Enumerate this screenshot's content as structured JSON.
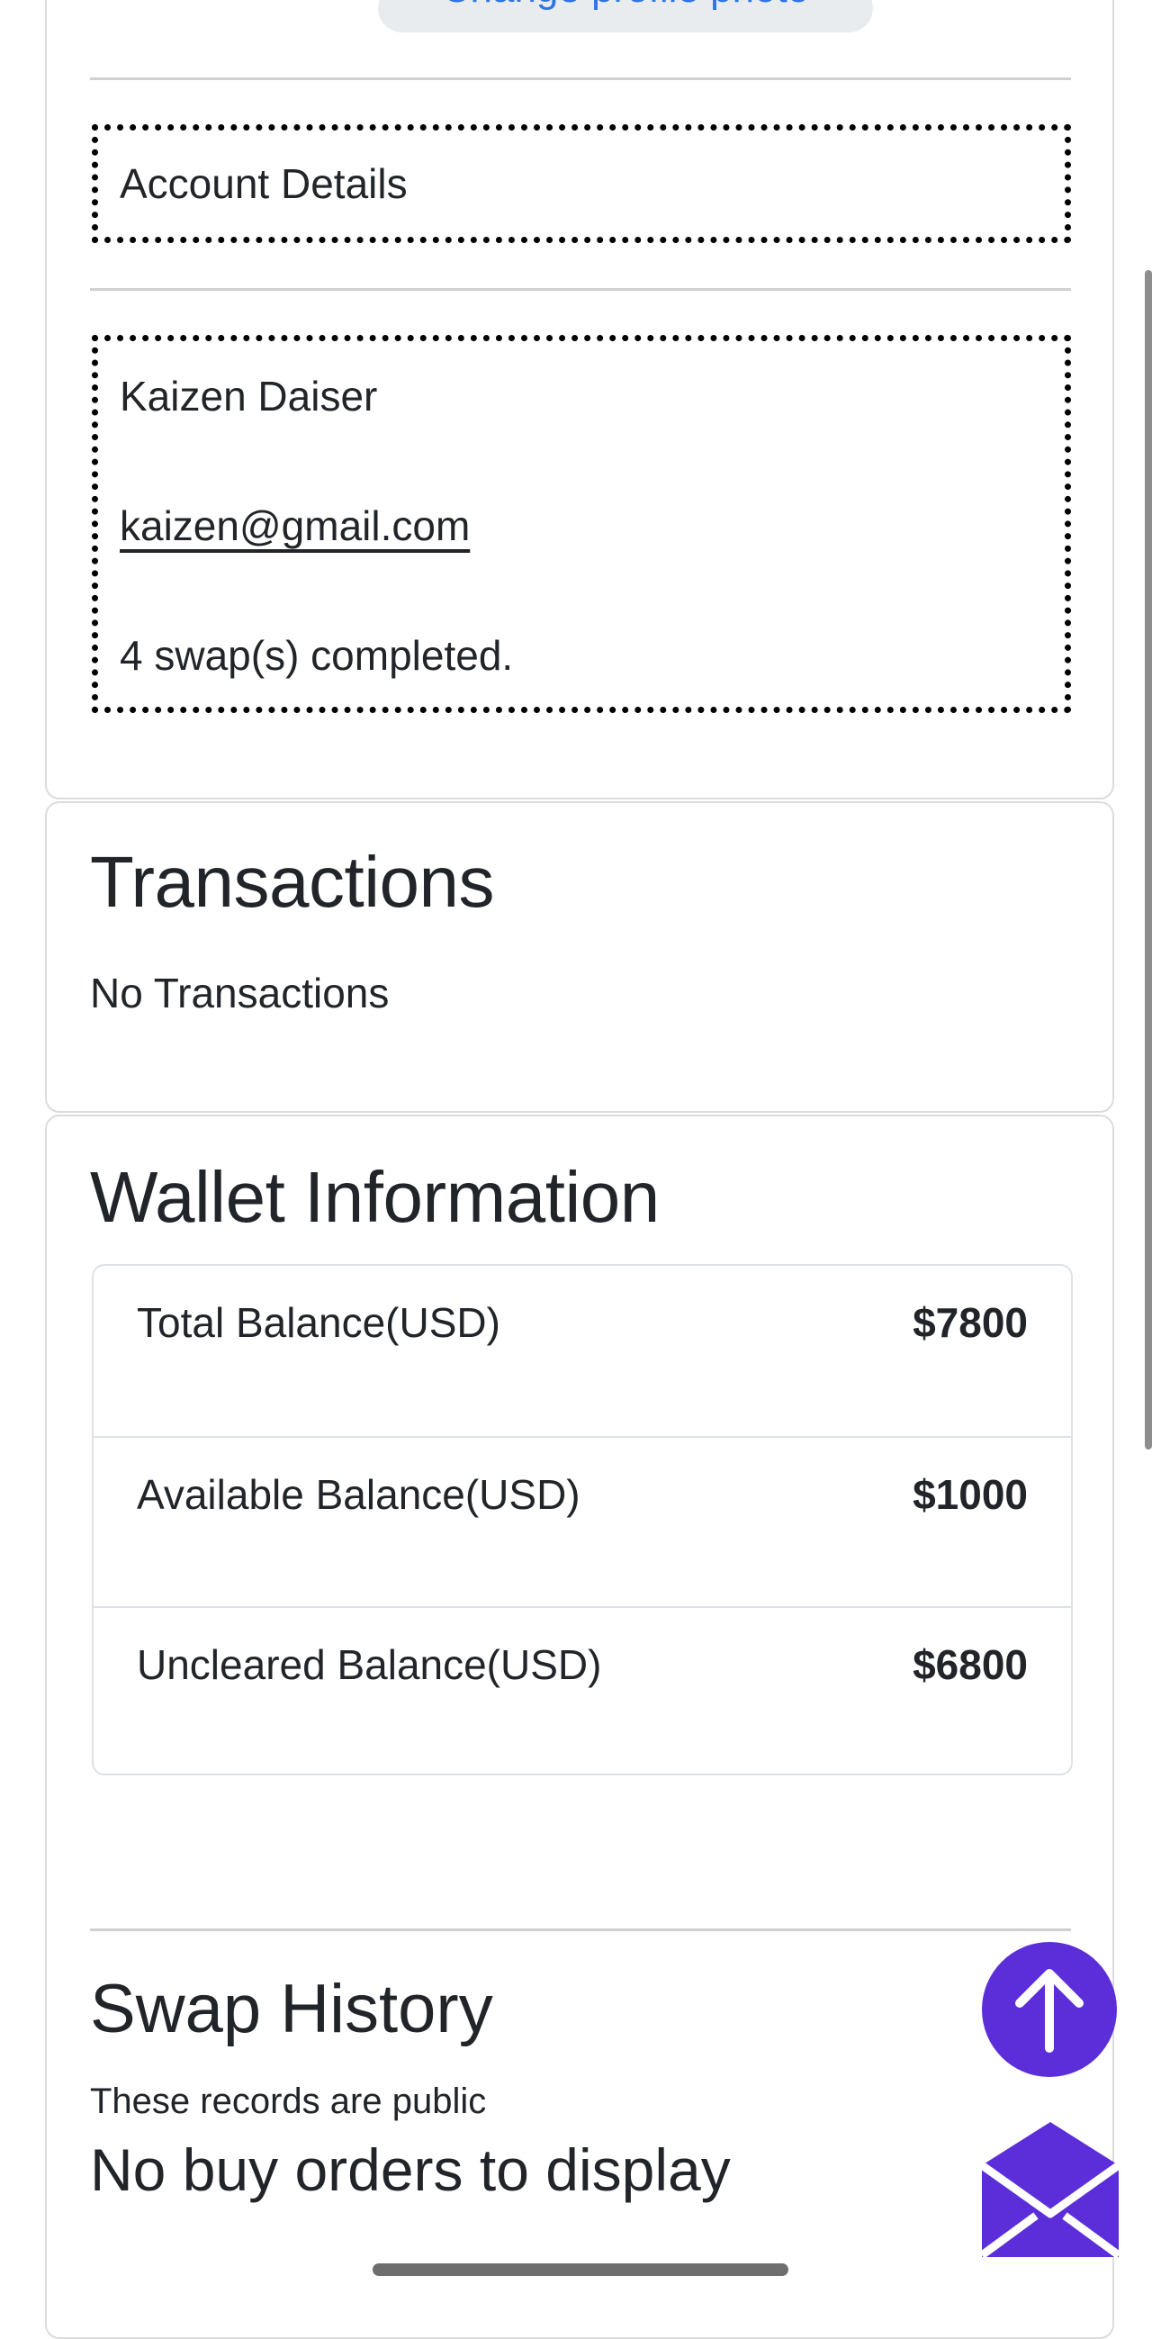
{
  "profile": {
    "change_photo_label": "Change profile photo",
    "account_details_label": "Account Details",
    "user_name": "Kaizen Daiser",
    "user_email": "kaizen@gmail.com",
    "swaps_completed": "4 swap(s) completed."
  },
  "transactions": {
    "title": "Transactions",
    "empty_text": "No Transactions"
  },
  "wallet": {
    "title": "Wallet Information",
    "balances": [
      {
        "label": "Total Balance(USD)",
        "value": "$7800"
      },
      {
        "label": "Available Balance(USD)",
        "value": "$1000"
      },
      {
        "label": "Uncleared Balance(USD)",
        "value": "$6800"
      }
    ]
  },
  "swap_history": {
    "title": "Swap History",
    "subtitle": "These records are public",
    "empty_text": "No buy orders to display"
  },
  "icons": {
    "scroll_top": "arrow-up-icon",
    "mail": "envelope-open-icon"
  },
  "colors": {
    "accent": "#5b2ed9",
    "link": "#2f74e0",
    "border": "#dcdcdc",
    "text": "#212529"
  }
}
